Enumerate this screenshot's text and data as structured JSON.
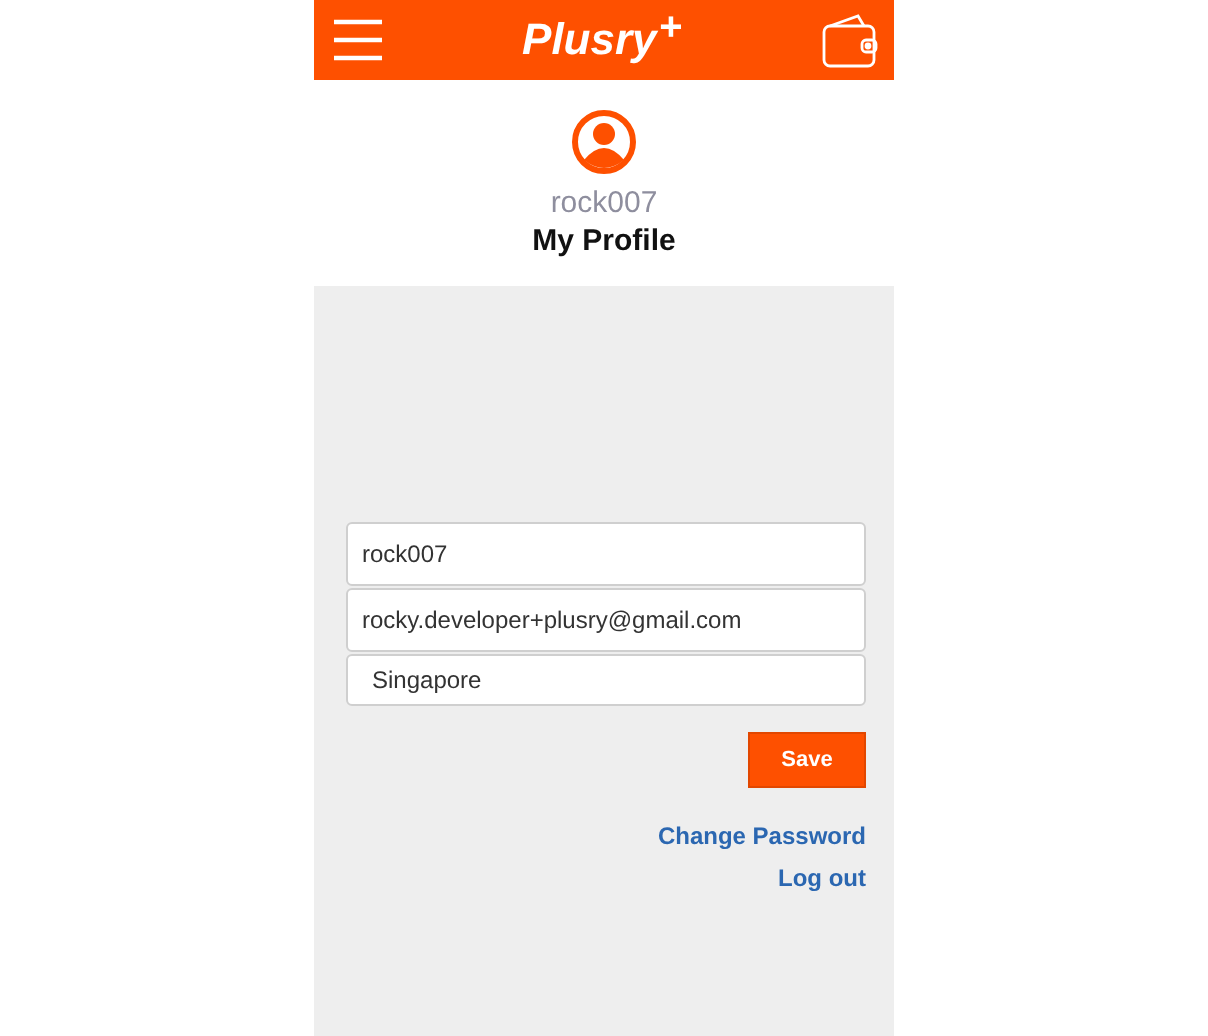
{
  "header": {
    "logo": "Plusry",
    "logo_mark": "+"
  },
  "profile": {
    "username": "rock007",
    "title": "My Profile"
  },
  "fields": [
    {
      "kind": "input",
      "value": "rock007"
    },
    {
      "kind": "input",
      "value": "rocky.developer+plusry@gmail.com"
    },
    {
      "kind": "select",
      "value": "Singapore"
    }
  ],
  "save_button": "Save",
  "links": [
    "Change Password",
    "Log out"
  ]
}
